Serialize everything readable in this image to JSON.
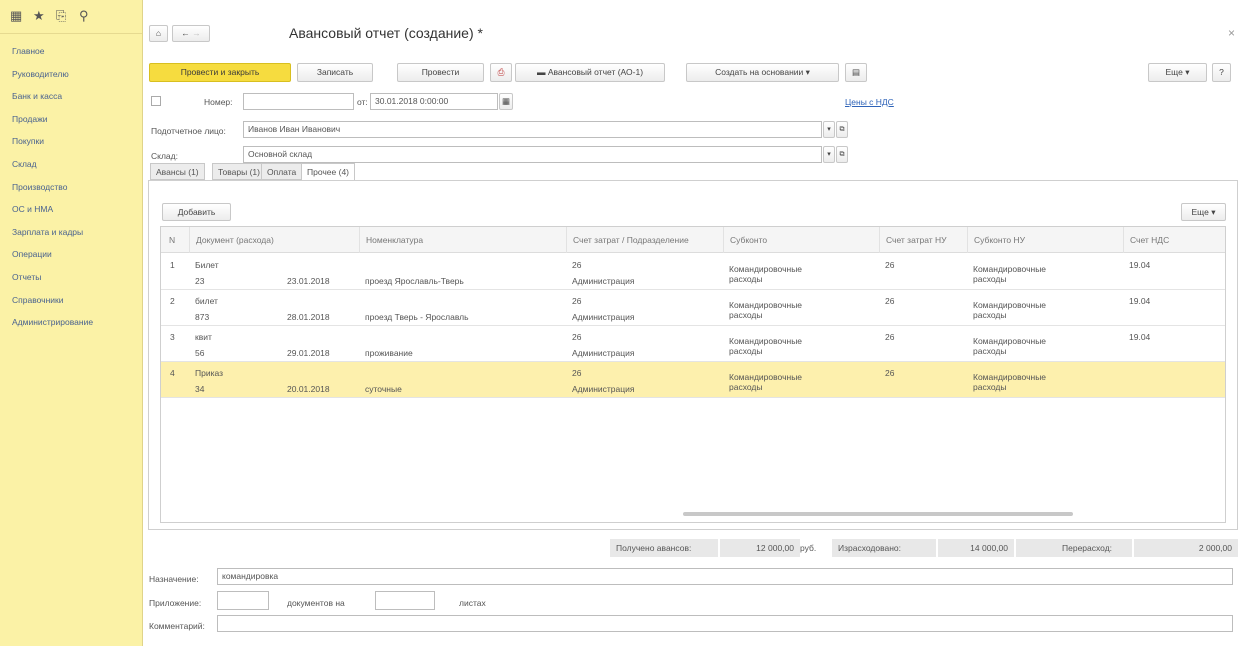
{
  "sidebar": {
    "items": [
      {
        "label": "Главное"
      },
      {
        "label": "Руководителю"
      },
      {
        "label": "Банк и касса"
      },
      {
        "label": "Продажи"
      },
      {
        "label": "Покупки"
      },
      {
        "label": "Склад"
      },
      {
        "label": "Производство"
      },
      {
        "label": "ОС и НМА"
      },
      {
        "label": "Зарплата и кадры"
      },
      {
        "label": "Операции"
      },
      {
        "label": "Отчеты"
      },
      {
        "label": "Справочники"
      },
      {
        "label": "Администрирование"
      }
    ]
  },
  "header": {
    "title": "Авансовый отчет (создание) *",
    "close": "×"
  },
  "toolbar": {
    "post_close": "Провести и закрыть",
    "save": "Записать",
    "post": "Провести",
    "print": "Авансовый отчет (АО-1)",
    "create_based": "Создать на основании",
    "more": "Еще",
    "help": "?"
  },
  "form": {
    "number_label": "Номер:",
    "number_value": "",
    "date_from_label": "от:",
    "date_value": "30.01.2018 0:00:00",
    "vat_link": "Цены с НДС",
    "person_label": "Подотчетное лицо:",
    "person_value": "Иванов Иван Иванович",
    "warehouse_label": "Склад:",
    "warehouse_value": "Основной склад"
  },
  "tabs": [
    {
      "label": "Авансы (1)"
    },
    {
      "label": "Товары (1)"
    },
    {
      "label": "Оплата"
    },
    {
      "label": "Прочее (4)"
    }
  ],
  "table": {
    "add_button": "Добавить",
    "more_button": "Еще",
    "headers": [
      "N",
      "Документ (расхода)",
      "Номенклатура",
      "Счет затрат / Подразделение",
      "Субконто",
      "Счет затрат НУ",
      "Субконто НУ",
      "Счет НДС"
    ],
    "rows": [
      {
        "n": "1",
        "doc": "Билет",
        "docnum": "23",
        "date": "23.01.2018",
        "item": "проезд Ярославль-Тверь",
        "acc": "26",
        "dept": "Администрация",
        "sub": "Командировочные расходы",
        "accnu": "26",
        "subnu": "Командировочные расходы",
        "vat": "19.04"
      },
      {
        "n": "2",
        "doc": "билет",
        "docnum": "873",
        "date": "28.01.2018",
        "item": "проезд Тверь - Ярославль",
        "acc": "26",
        "dept": "Администрация",
        "sub": "Командировочные расходы",
        "accnu": "26",
        "subnu": "Командировочные расходы",
        "vat": "19.04"
      },
      {
        "n": "3",
        "doc": "квит",
        "docnum": "56",
        "date": "29.01.2018",
        "item": "проживание",
        "acc": "26",
        "dept": "Администрация",
        "sub": "Командировочные расходы",
        "accnu": "26",
        "subnu": "Командировочные расходы",
        "vat": "19.04"
      },
      {
        "n": "4",
        "doc": "Приказ",
        "docnum": "34",
        "date": "20.01.2018",
        "item": "суточные",
        "acc": "26",
        "dept": "Администрация",
        "sub": "Командировочные расходы",
        "accnu": "26",
        "subnu": "Командировочные расходы",
        "vat": ""
      }
    ]
  },
  "totals": {
    "received_label": "Получено авансов:",
    "received_value": "12 000,00",
    "currency": "руб.",
    "spent_label": "Израсходовано:",
    "spent_value": "14 000,00",
    "overspent_label": "Перерасход:",
    "overspent_value": "2 000,00"
  },
  "footer": {
    "purpose_label": "Назначение:",
    "purpose_value": "командировка",
    "attachment_label": "Приложение:",
    "docs_on_label": "документов на",
    "sheets_label": "листах",
    "comment_label": "Комментарий:"
  }
}
